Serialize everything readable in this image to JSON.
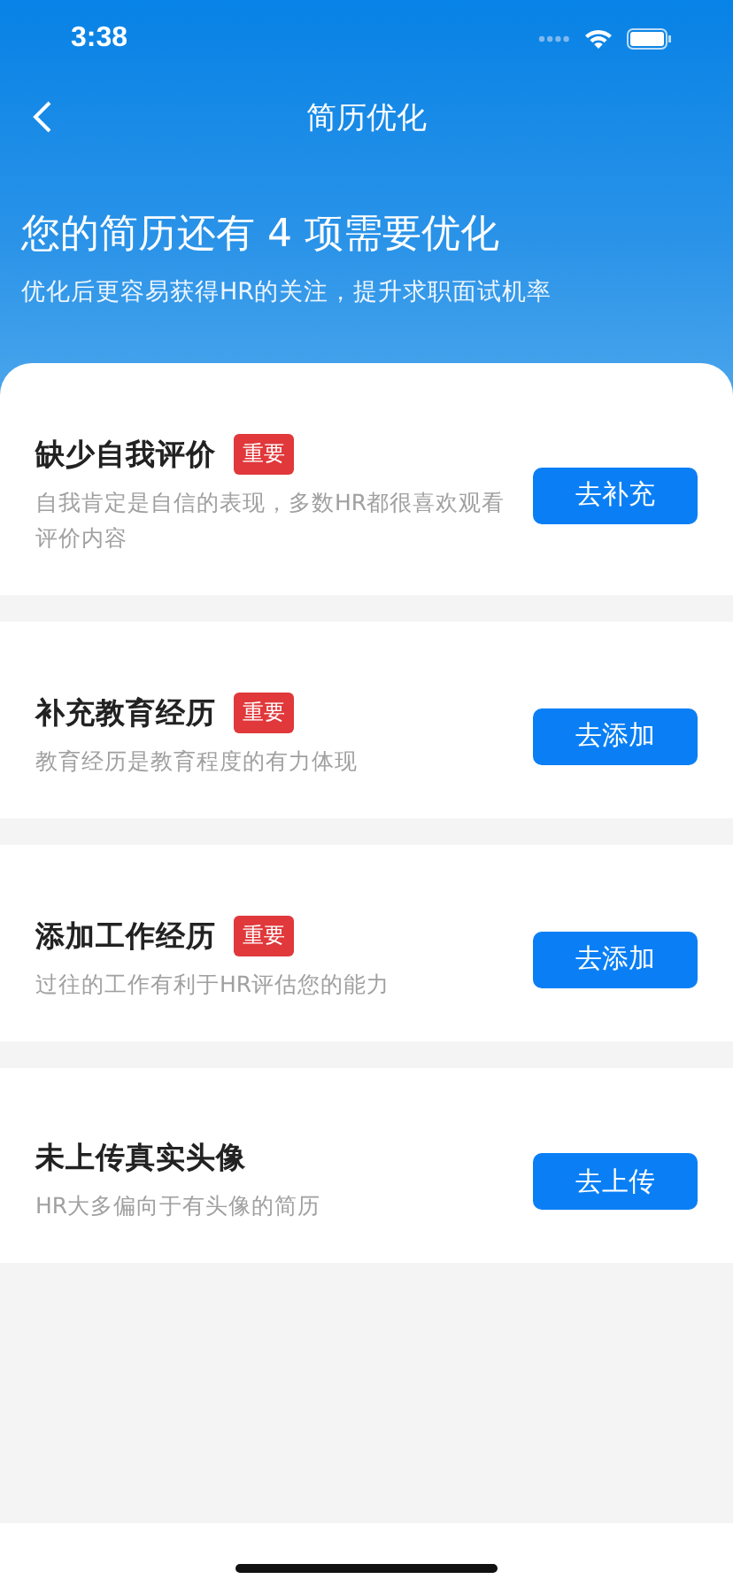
{
  "status_bar": {
    "time": "3:38"
  },
  "nav": {
    "title": "简历优化"
  },
  "hero": {
    "headline": "您的简历还有 4 项需要优化",
    "subtitle": "优化后更容易获得HR的关注，提升求职面试机率"
  },
  "items": [
    {
      "title": "缺少自我评价",
      "badge": "重要",
      "description": "自我肯定是自信的表现，多数HR都很喜欢观看评价内容",
      "action": "去补充"
    },
    {
      "title": "补充教育经历",
      "badge": "重要",
      "description": "教育经历是教育程度的有力体现",
      "action": "去添加"
    },
    {
      "title": "添加工作经历",
      "badge": "重要",
      "description": "过往的工作有利于HR评估您的能力",
      "action": "去添加"
    },
    {
      "title": "未上传真实头像",
      "description": "HR大多偏向于有头像的简历",
      "action": "去上传"
    }
  ]
}
